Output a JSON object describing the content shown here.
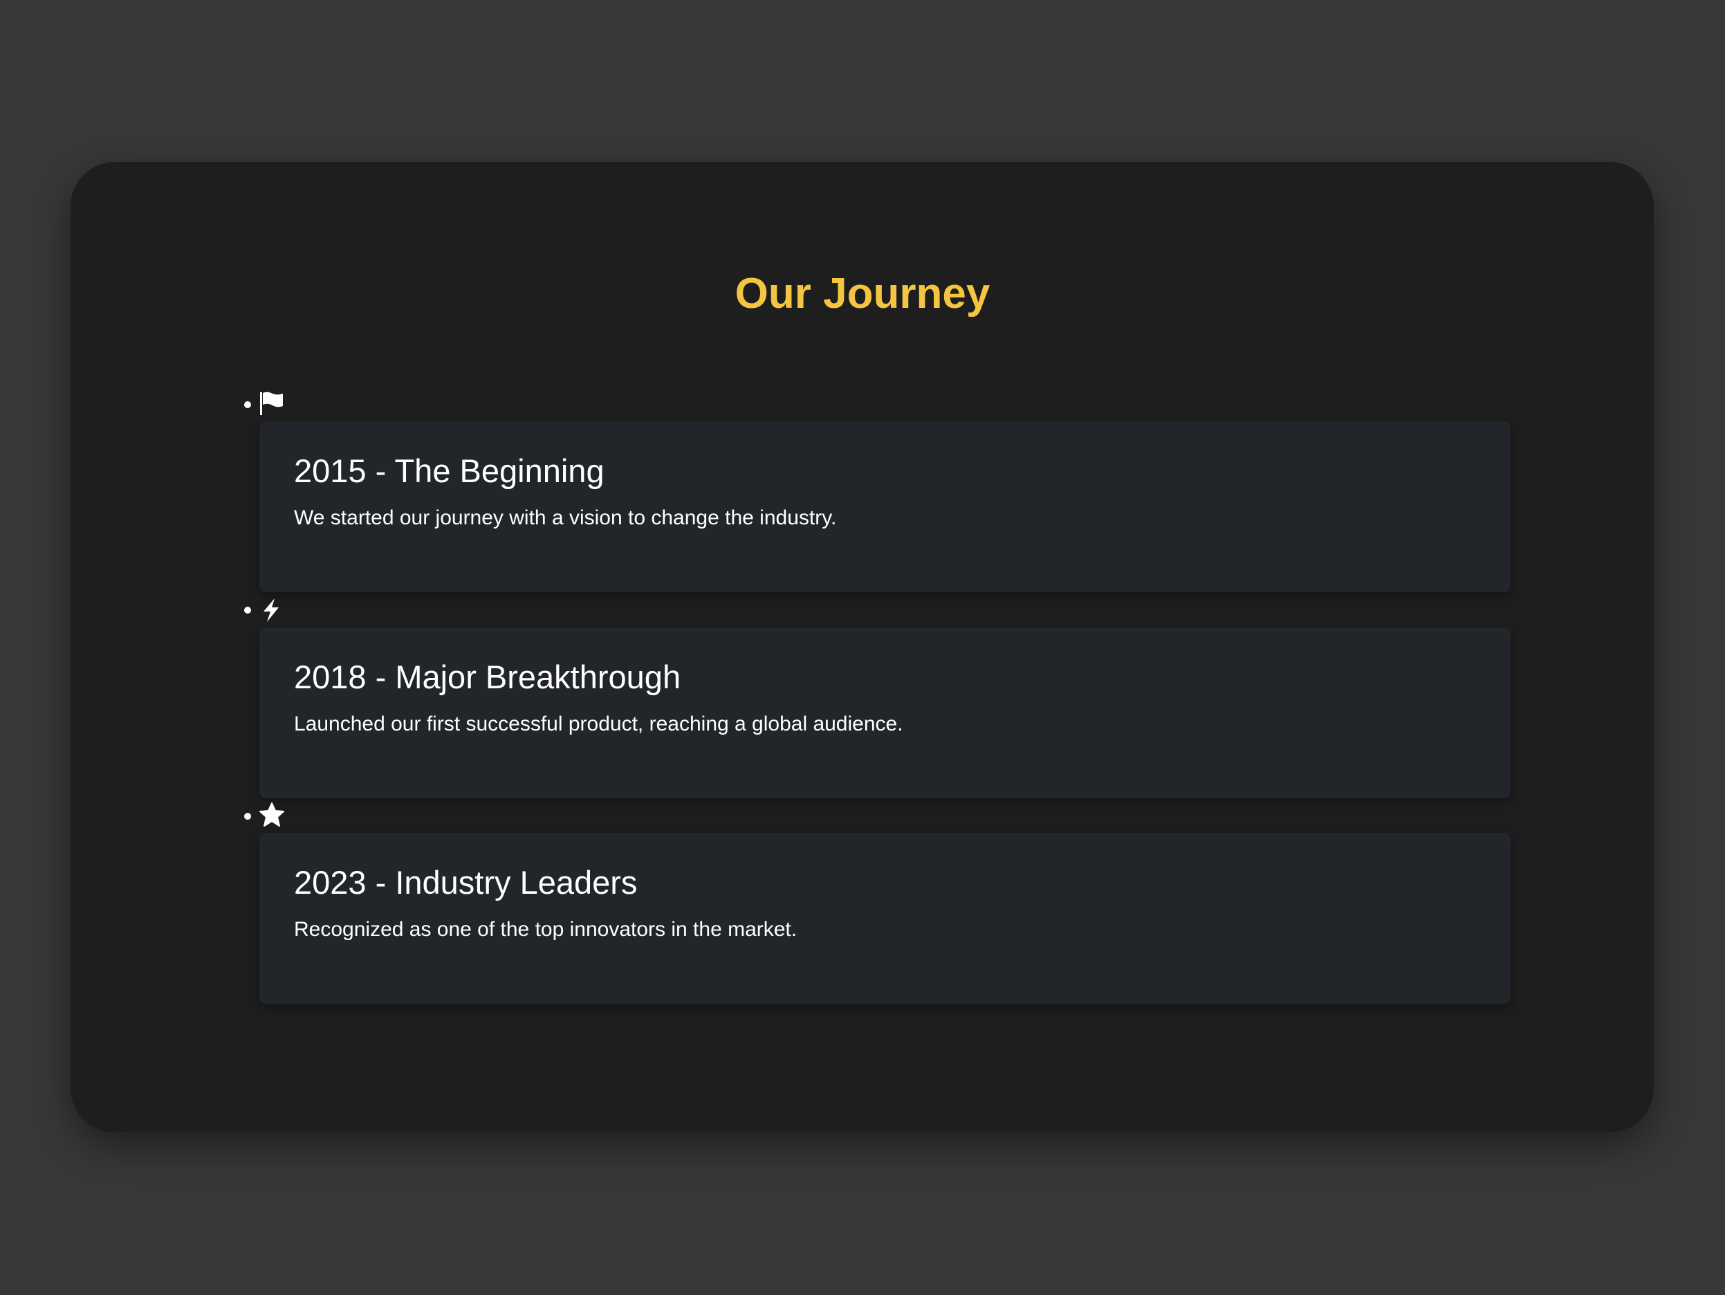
{
  "title": "Our Journey",
  "colors": {
    "accent": "#f5c542",
    "card": "#22252a",
    "container": "#1e1e1e",
    "background": "#383838"
  },
  "milestones": [
    {
      "icon": "flag-icon",
      "heading": "2015 - The Beginning",
      "text": "We started our journey with a vision to change the industry."
    },
    {
      "icon": "bolt-icon",
      "heading": "2018 - Major Breakthrough",
      "text": "Launched our first successful product, reaching a global audience."
    },
    {
      "icon": "star-icon",
      "heading": "2023 - Industry Leaders",
      "text": "Recognized as one of the top innovators in the market."
    }
  ]
}
